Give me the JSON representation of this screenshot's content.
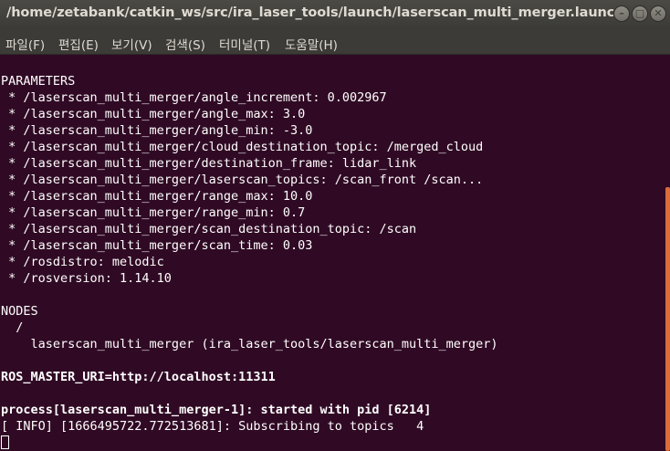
{
  "window": {
    "title": "/home/zetabank/catkin_ws/src/ira_laser_tools/launch/laserscan_multi_merger.launch http:...",
    "minimize_glyph": "–",
    "maximize_glyph": "□",
    "close_glyph": "✕"
  },
  "menu": {
    "items": [
      "파일(F)",
      "편집(E)",
      "보기(V)",
      "검색(S)",
      "터미널(T)",
      "도움말(H)"
    ]
  },
  "terminal": {
    "lines": [
      {
        "text": "PARAMETERS",
        "bold": false
      },
      {
        "text": " * /laserscan_multi_merger/angle_increment: 0.002967",
        "bold": false
      },
      {
        "text": " * /laserscan_multi_merger/angle_max: 3.0",
        "bold": false
      },
      {
        "text": " * /laserscan_multi_merger/angle_min: -3.0",
        "bold": false
      },
      {
        "text": " * /laserscan_multi_merger/cloud_destination_topic: /merged_cloud",
        "bold": false
      },
      {
        "text": " * /laserscan_multi_merger/destination_frame: lidar_link",
        "bold": false
      },
      {
        "text": " * /laserscan_multi_merger/laserscan_topics: /scan_front /scan...",
        "bold": false
      },
      {
        "text": " * /laserscan_multi_merger/range_max: 10.0",
        "bold": false
      },
      {
        "text": " * /laserscan_multi_merger/range_min: 0.7",
        "bold": false
      },
      {
        "text": " * /laserscan_multi_merger/scan_destination_topic: /scan",
        "bold": false
      },
      {
        "text": " * /laserscan_multi_merger/scan_time: 0.03",
        "bold": false
      },
      {
        "text": " * /rosdistro: melodic",
        "bold": false
      },
      {
        "text": " * /rosversion: 1.14.10",
        "bold": false
      },
      {
        "text": "",
        "bold": false
      },
      {
        "text": "NODES",
        "bold": false
      },
      {
        "text": "  /",
        "bold": false
      },
      {
        "text": "    laserscan_multi_merger (ira_laser_tools/laserscan_multi_merger)",
        "bold": false
      },
      {
        "text": "",
        "bold": false
      },
      {
        "text": "ROS_MASTER_URI=http://localhost:11311",
        "bold": true
      },
      {
        "text": "",
        "bold": false
      },
      {
        "text": "process[laserscan_multi_merger-1]: started with pid [6214]",
        "bold": true
      },
      {
        "text": "[ INFO] [1666495722.772513681]: Subscribing to topics   4",
        "bold": false
      }
    ]
  }
}
